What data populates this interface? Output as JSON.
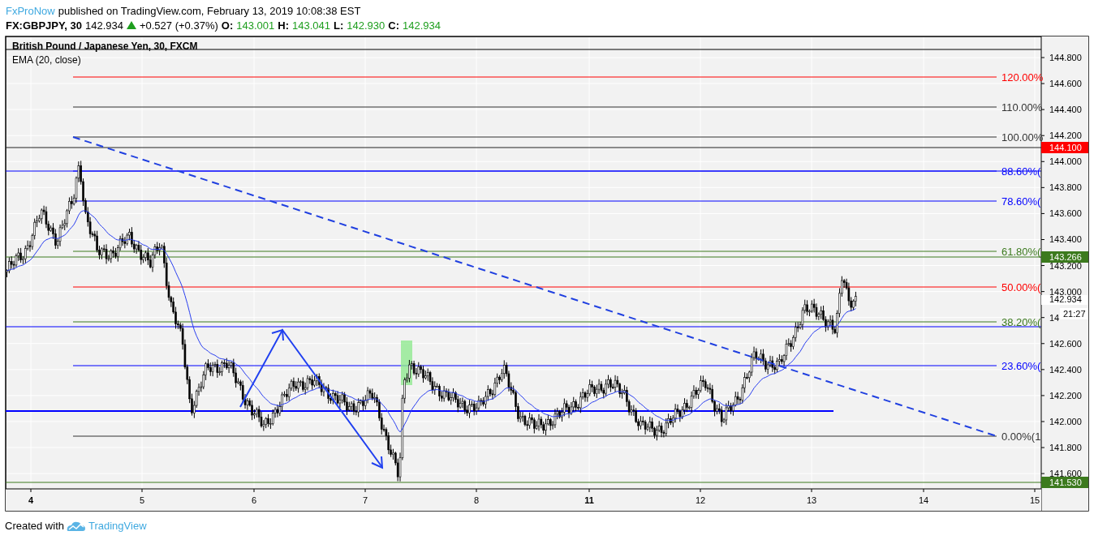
{
  "header": {
    "author": "FxProNow",
    "published": "published on TradingView.com, February 13, 2019 10:08:38 EST"
  },
  "quote": {
    "symbol": "FX:GBPJPY, 30",
    "last": "142.934",
    "change": "+0.527 (+0.37%)",
    "ohlc": [
      {
        "label": "O:",
        "value": "143.001"
      },
      {
        "label": "H:",
        "value": "143.041"
      },
      {
        "label": "L:",
        "value": "142.930"
      },
      {
        "label": "C:",
        "value": "142.934"
      }
    ]
  },
  "chart": {
    "title": "British Pound / Japanese Yen, 30, FXCM",
    "indicator": "EMA (20, close)",
    "fib_levels": [
      {
        "label": "120.00%",
        "color": "#ff0000"
      },
      {
        "label": "110.00%",
        "color": "#333333"
      },
      {
        "label": "100.00%",
        "color": "#333333"
      },
      {
        "label": "88.60%(",
        "color": "#0000ff"
      },
      {
        "label": "78.60%(",
        "color": "#0000ff"
      },
      {
        "label": "61.80%(",
        "color": "#3c7a1e"
      },
      {
        "label": "50.00%(",
        "color": "#ff0000"
      },
      {
        "label": "38.20%(",
        "color": "#3c7a1e"
      },
      {
        "label": "23.60%(",
        "color": "#0000ff"
      },
      {
        "label": "0.00%(1",
        "color": "#333333"
      }
    ],
    "price_ticks": [
      "144.800",
      "144.600",
      "144.400",
      "144.200",
      "144.000",
      "143.800",
      "143.600",
      "143.400",
      "143.200",
      "143.000",
      "14",
      "142.600",
      "142.400",
      "142.200",
      "142.000",
      "141.800",
      "141.600"
    ],
    "price_tags": [
      {
        "text": "144.100",
        "color": "#ff0000"
      },
      {
        "text": "143.266",
        "color": "#3c7a1e"
      },
      {
        "text": "142.934",
        "color": "#ffffff"
      },
      {
        "text": "21:27",
        "color": "#ffffff"
      },
      {
        "text": "141.530",
        "color": "#3c7a1e"
      }
    ],
    "time_ticks": [
      {
        "label": "4",
        "bold": true
      },
      {
        "label": "5",
        "bold": false
      },
      {
        "label": "6",
        "bold": false
      },
      {
        "label": "7",
        "bold": false
      },
      {
        "label": "8",
        "bold": false
      },
      {
        "label": "11",
        "bold": true
      },
      {
        "label": "12",
        "bold": false
      },
      {
        "label": "13",
        "bold": false
      },
      {
        "label": "14",
        "bold": false
      },
      {
        "label": "15",
        "bold": false
      }
    ]
  },
  "footer": {
    "text": "Created with",
    "brand": "TradingView"
  }
}
